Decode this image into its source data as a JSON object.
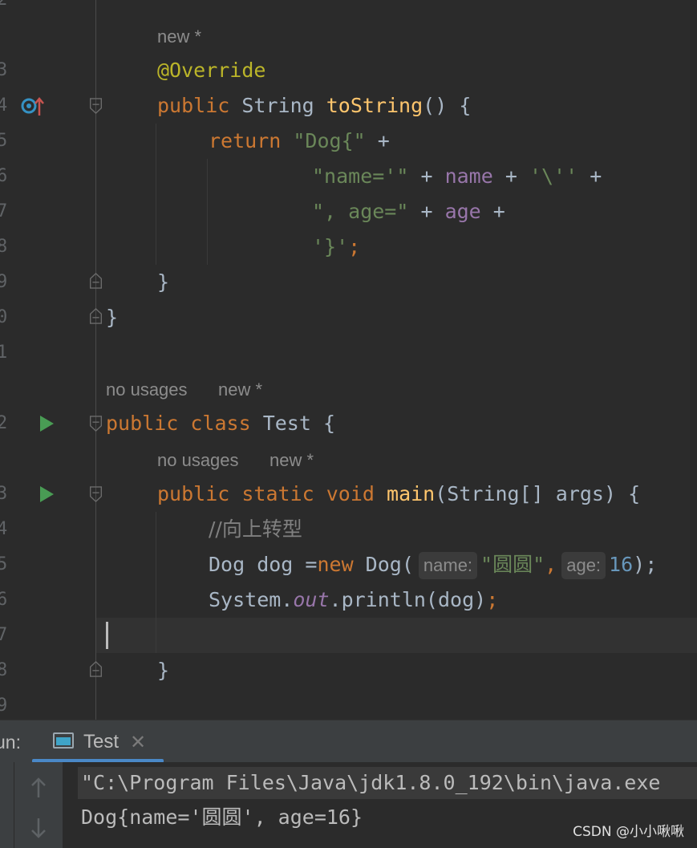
{
  "editor": {
    "line_numbers": [
      "2",
      "3",
      "4",
      "5",
      "6",
      "7",
      "8",
      "9",
      "0",
      "1",
      "2",
      "3",
      "4",
      "5",
      "6",
      "7",
      "8",
      "9"
    ],
    "lens_1": "new *",
    "annotation": "@Override",
    "tostring_kw": "public",
    "tostring_type": "String",
    "tostring_name": "toString",
    "tostring_rest": "() {",
    "return_kw": "return",
    "return_str": "\"Dog{\"",
    "return_plus": " +",
    "name_str": "\"name='\"",
    "plus1": " + ",
    "name_field": "name",
    "plus2": " + ",
    "quote_char": "'\\''",
    "plus3": " +",
    "age_str": "\", age=\"",
    "plus4": " + ",
    "age_field": "age",
    "plus5": " +",
    "close_char": "'}'",
    "semicolon": ";",
    "close_brace_inner": "}",
    "close_brace_class": "}",
    "lens_2_usages": "no usages",
    "lens_2_new": "new *",
    "class_kw1": "public",
    "class_kw2": "class",
    "class_name": "Test {",
    "lens_3_usages": "no usages",
    "lens_3_new": "new *",
    "main_kw1": "public",
    "main_kw2": "static",
    "main_kw3": "void",
    "main_name": "main",
    "main_params": "(String[] args) {",
    "comment": "//向上转型",
    "dog_decl": "Dog dog =",
    "new_kw": "new",
    "dog_ctor": " Dog(",
    "hint_name": "name:",
    "dog_name_str": "\"圆圆\"",
    "comma": ",",
    "hint_age": "age:",
    "dog_age_num": "16",
    "dog_close": ");",
    "sys": "System.",
    "out": "out",
    "println": ".println(dog)",
    "println_semi": ";",
    "main_close": "}"
  },
  "run_panel": {
    "label": "un:",
    "tab_label": "Test",
    "tab_close": "✕",
    "cmd_line": "\"C:\\Program Files\\Java\\jdk1.8.0_192\\bin\\java.exe",
    "output": "Dog{name='圆圆', age=16}"
  },
  "watermark": "CSDN @小小啾啾",
  "colors": {
    "background": "#2b2b2b",
    "keyword": "#cc7832",
    "string": "#6a8759",
    "annotation": "#bbb529",
    "field": "#9876aa",
    "method": "#ffc66d",
    "number": "#6897bb",
    "run_icon": "#499c54",
    "tab_accent": "#4a88c7"
  },
  "icons": [
    "override-icon",
    "run-icon",
    "fold-icon",
    "console-icon",
    "close-icon",
    "arrow-up-icon",
    "arrow-down-icon"
  ]
}
